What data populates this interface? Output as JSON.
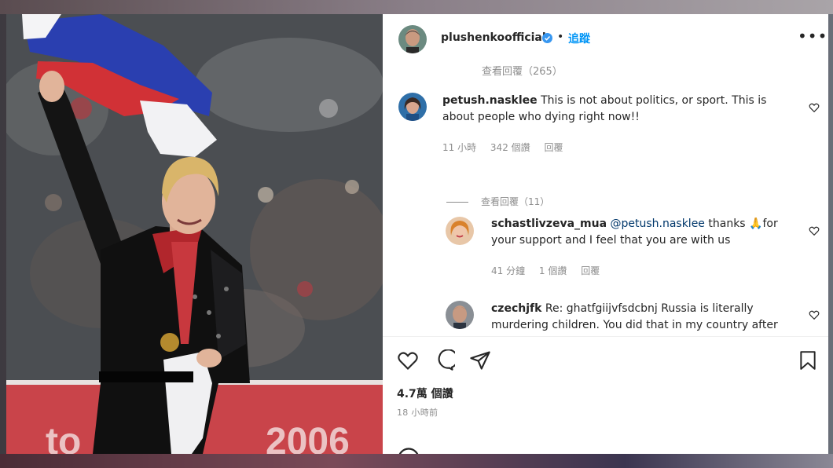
{
  "header": {
    "username": "plushenkoofficial",
    "separator": "•",
    "follow_label": "追蹤",
    "more_label": "•••"
  },
  "comments": {
    "cut_off_text": "查看回覆（265）",
    "items": [
      {
        "username": "petush.nasklee",
        "text": "This is not about politics, or sport. This is about people who dying right now!!",
        "time": "11 小時",
        "likes": "342 個讚",
        "reply": "回覆",
        "view_replies": "查看回覆（11）"
      },
      {
        "username": "schastlivzeva_mua",
        "mention": "@petush.nasklee",
        "text_pre": "thanks",
        "emoji": "🙏",
        "text_post": "for your support and I feel that you are with us",
        "time": "41 分鐘",
        "likes": "1 個讚",
        "reply": "回覆"
      },
      {
        "username": "czechjfk",
        "text": "Re: ghatfgiijvfsdcbnj Russia is literally murdering children. You did that in my country after"
      }
    ]
  },
  "post": {
    "likes": "4.7萬 個讚",
    "time": "18 小時前"
  },
  "colors": {
    "link_blue": "#0095f6",
    "verified_blue": "#3897f0",
    "text": "#262626",
    "muted": "#8e8e8e"
  }
}
